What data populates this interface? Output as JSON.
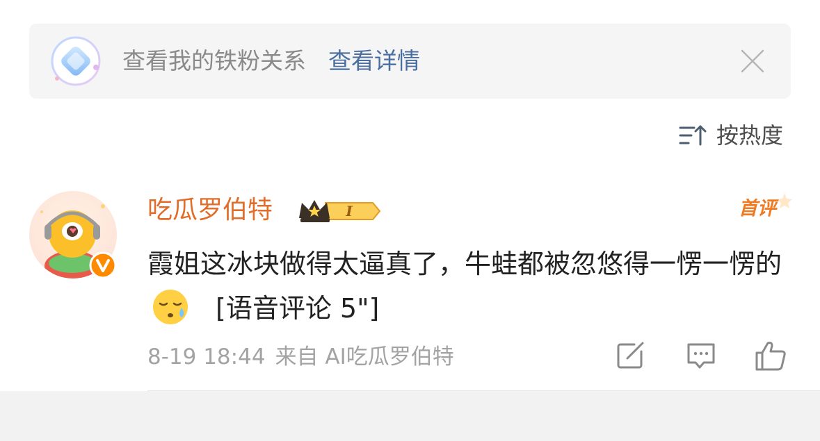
{
  "fan_banner": {
    "text": "查看我的铁粉关系",
    "link": "查看详情",
    "icon": "diamond-icon",
    "close_icon": "close-icon"
  },
  "sort": {
    "label": "按热度",
    "icon": "sort-icon"
  },
  "comment": {
    "username": "吃瓜罗伯特",
    "vip_level": "I",
    "first_badge": "首评",
    "text": "霞姐这冰块做得太逼真了，牛蛙都被忽悠得一愣一愣的",
    "emoji": "sweat-emoji",
    "voice": "[语音评论 5\"]",
    "time": "8-19 18:44",
    "source": "来自 AI吃瓜罗伯特",
    "actions": [
      "repost-icon",
      "comment-icon",
      "like-icon"
    ]
  },
  "colors": {
    "username": "#e06d2a",
    "link": "#4a6ea0",
    "meta": "#a3a3a3",
    "banner_bg": "#f5f5f5",
    "bottom_bg": "#f2f2f2"
  }
}
